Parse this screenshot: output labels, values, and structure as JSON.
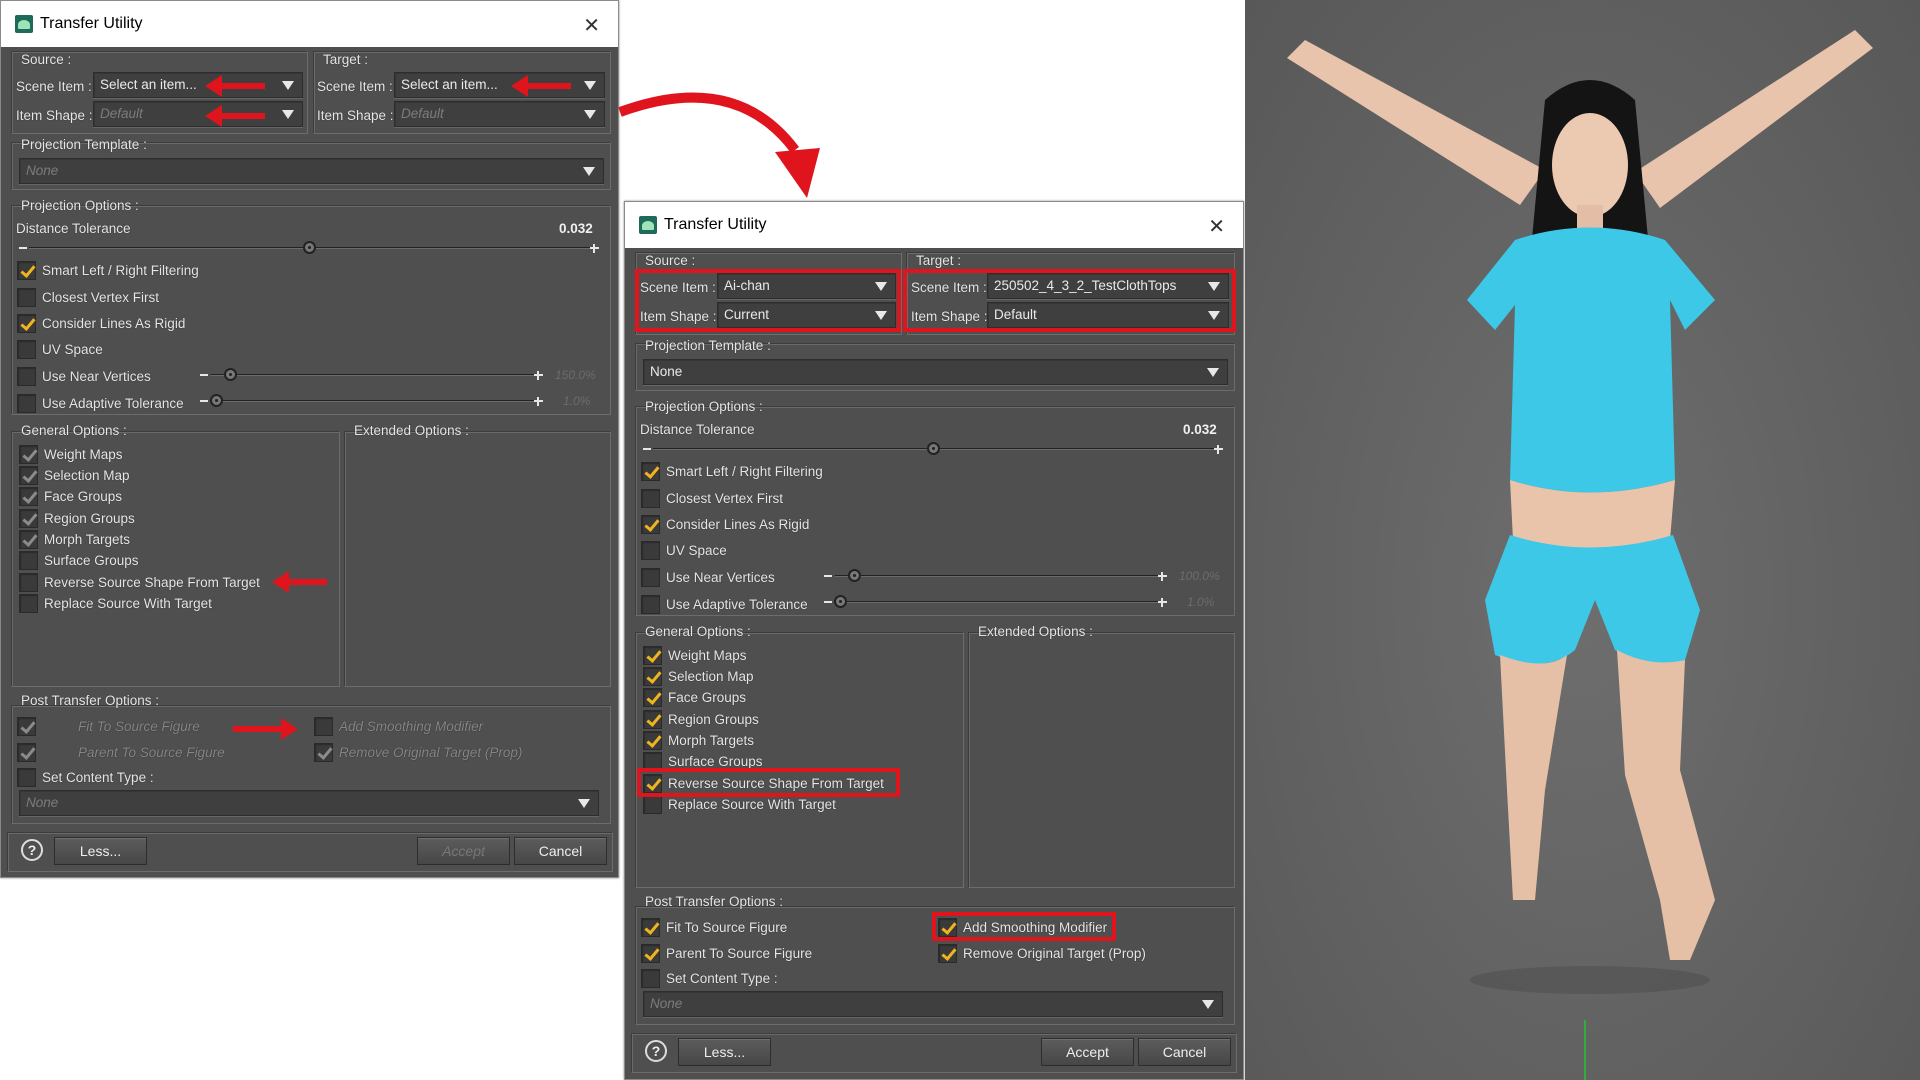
{
  "dialog": {
    "title": "Transfer Utility",
    "source_label": "Source :",
    "target_label": "Target :",
    "scene_item_label": "Scene Item :",
    "item_shape_label": "Item Shape :",
    "projection_template_label": "Projection Template :",
    "projection_options_label": "Projection Options :",
    "distance_tolerance_label": "Distance Tolerance",
    "smart_filtering": "Smart Left / Right Filtering",
    "closest_vertex": "Closest Vertex First",
    "consider_lines": "Consider Lines As Rigid",
    "uv_space": "UV Space",
    "use_near_vertices": "Use Near Vertices",
    "use_adaptive_tolerance": "Use Adaptive Tolerance",
    "general_options_label": "General Options :",
    "extended_options_label": "Extended Options :",
    "weight_maps": "Weight Maps",
    "selection_map": "Selection Map",
    "face_groups": "Face Groups",
    "region_groups": "Region Groups",
    "morph_targets": "Morph Targets",
    "surface_groups": "Surface Groups",
    "reverse_source_shape": "Reverse Source Shape From Target",
    "replace_source": "Replace Source With Target",
    "post_transfer_label": "Post Transfer Options :",
    "fit_to_source": "Fit To Source Figure",
    "parent_to_source": "Parent To Source Figure",
    "add_smoothing": "Add Smoothing Modifier",
    "remove_original": "Remove Original Target (Prop)",
    "set_content_type": "Set Content Type :",
    "less_button": "Less...",
    "accept_button": "Accept",
    "cancel_button": "Cancel",
    "help_glyph": "?"
  },
  "before": {
    "source_scene_item": "Select an item...",
    "source_item_shape": "Default",
    "target_scene_item": "Select an item...",
    "target_item_shape": "Default",
    "projection_template": "None",
    "distance_tolerance": "0.032",
    "near_vertices_value": "150.0%",
    "adaptive_value": "1.0%",
    "content_type": "None"
  },
  "after": {
    "source_scene_item": "Ai-chan",
    "source_item_shape": "Current",
    "target_scene_item": "250502_4_3_2_TestClothTops",
    "target_item_shape": "Default",
    "projection_template": "None",
    "distance_tolerance": "0.032",
    "near_vertices_value": "100.0%",
    "adaptive_value": "1.0%",
    "content_type": "None"
  },
  "colors": {
    "annotation_red": "#e0141d",
    "check_yellow": "#f0b51e",
    "panel_gray": "#4f4f4f",
    "top_color": "#3cc8e6"
  },
  "icons": [
    "transfer-utility-icon",
    "close-icon",
    "chevron-down-icon",
    "help-icon",
    "checkmark-icon",
    "red-arrow-icon"
  ]
}
